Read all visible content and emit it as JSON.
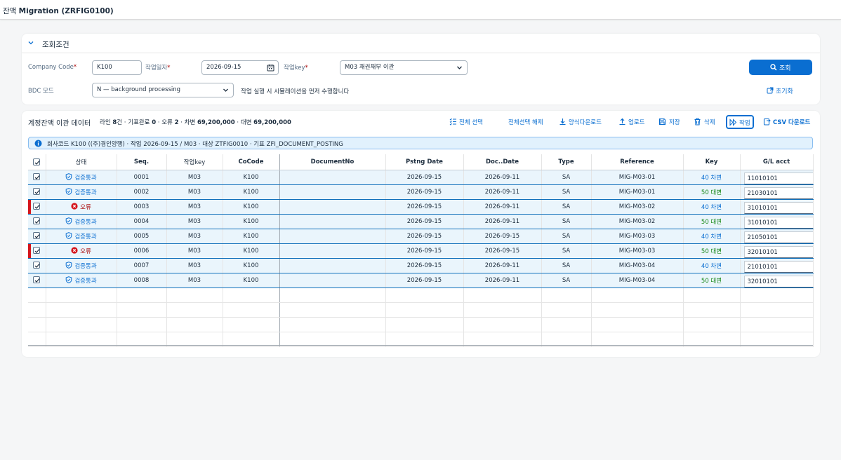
{
  "app": {
    "title_prefix": "잔액",
    "title_bold": "Migration (ZRFIG0100)"
  },
  "filter": {
    "section_title": "조회조건",
    "company_code_label": "Company Code",
    "company_code_value": "K100",
    "work_date_label": "작업일자",
    "work_date_value": "2026-09-15",
    "work_key_label": "작업key",
    "work_key_value": "M03 채권채무 이관",
    "bdc_label": "BDC 모드",
    "bdc_value": "N — background processing",
    "note": "작업 실행 시 시뮬레이션을 먼저 수행합니다",
    "search_label": "조회",
    "reset_label": "초기화",
    "required_mark": "*"
  },
  "toolbar": {
    "title": "계정잔액 이관 데이터",
    "stats": {
      "lines_label": "라인",
      "lines": "8",
      "lines_unit": "건 · 기표완료",
      "posted": "0",
      "err_label": " · 오류",
      "errors": "2",
      "debit_label": " · 차변",
      "debit": "69,200,000",
      "credit_label": " · 대변",
      "credit": "69,200,000"
    },
    "select_all": "전체 선택",
    "deselect_all": "전체선택 해제",
    "template_download": "양식다운로드",
    "upload": "업로드",
    "save": "저장",
    "delete": "삭제",
    "execute": "작업",
    "csv_download": "CSV 다운로드"
  },
  "info": "회사코드 K100 ((주)경인양행) · 작업 2026-09-15 / M03 · 대상 ZTFIG0010 · 기표 ZFI_DOCUMENT_POSTING",
  "table": {
    "columns": [
      "상태",
      "Seq.",
      "작업key",
      "CoCode",
      "DocumentNo",
      "Pstng Date",
      "Doc..Date",
      "Type",
      "Reference",
      "Key",
      "G/L acct"
    ],
    "rows": [
      {
        "status": "검증통과",
        "status_type": "ok",
        "seq": "0001",
        "key": "M03",
        "cocode": "K100",
        "docno": "",
        "pdate": "2026-09-15",
        "ddate": "2026-09-11",
        "type": "SA",
        "ref": "MIG-M03-01",
        "pkey": "40 차변",
        "pkey_type": "debit",
        "gl": "11010101"
      },
      {
        "status": "검증통과",
        "status_type": "ok",
        "seq": "0002",
        "key": "M03",
        "cocode": "K100",
        "docno": "",
        "pdate": "2026-09-15",
        "ddate": "2026-09-11",
        "type": "SA",
        "ref": "MIG-M03-01",
        "pkey": "50 대변",
        "pkey_type": "credit",
        "gl": "21030101"
      },
      {
        "status": "오류",
        "status_type": "err",
        "seq": "0003",
        "key": "M03",
        "cocode": "K100",
        "docno": "",
        "pdate": "2026-09-15",
        "ddate": "2026-09-11",
        "type": "SA",
        "ref": "MIG-M03-02",
        "pkey": "40 차변",
        "pkey_type": "debit",
        "gl": "31010101"
      },
      {
        "status": "검증통과",
        "status_type": "ok",
        "seq": "0004",
        "key": "M03",
        "cocode": "K100",
        "docno": "",
        "pdate": "2026-09-15",
        "ddate": "2026-09-11",
        "type": "SA",
        "ref": "MIG-M03-02",
        "pkey": "50 대변",
        "pkey_type": "credit",
        "gl": "31010101"
      },
      {
        "status": "검증통과",
        "status_type": "ok",
        "seq": "0005",
        "key": "M03",
        "cocode": "K100",
        "docno": "",
        "pdate": "2026-09-15",
        "ddate": "2026-09-15",
        "type": "SA",
        "ref": "MIG-M03-03",
        "pkey": "40 차변",
        "pkey_type": "debit",
        "gl": "21050101"
      },
      {
        "status": "오류",
        "status_type": "err",
        "seq": "0006",
        "key": "M03",
        "cocode": "K100",
        "docno": "",
        "pdate": "2026-09-15",
        "ddate": "2026-09-15",
        "type": "SA",
        "ref": "MIG-M03-03",
        "pkey": "50 대변",
        "pkey_type": "credit",
        "gl": "32010101"
      },
      {
        "status": "검증통과",
        "status_type": "ok",
        "seq": "0007",
        "key": "M03",
        "cocode": "K100",
        "docno": "",
        "pdate": "2026-09-15",
        "ddate": "2026-09-11",
        "type": "SA",
        "ref": "MIG-M03-04",
        "pkey": "40 차변",
        "pkey_type": "debit",
        "gl": "21010101"
      },
      {
        "status": "검증통과",
        "status_type": "ok",
        "seq": "0008",
        "key": "M03",
        "cocode": "K100",
        "docno": "",
        "pdate": "2026-09-15",
        "ddate": "2026-09-11",
        "type": "SA",
        "ref": "MIG-M03-04",
        "pkey": "50 대변",
        "pkey_type": "credit",
        "gl": "32010101"
      }
    ]
  },
  "colors": {
    "brand": "#0a6ed1",
    "error": "#d5151c",
    "success": "#188918",
    "row_selected": "#eaf5fc"
  }
}
